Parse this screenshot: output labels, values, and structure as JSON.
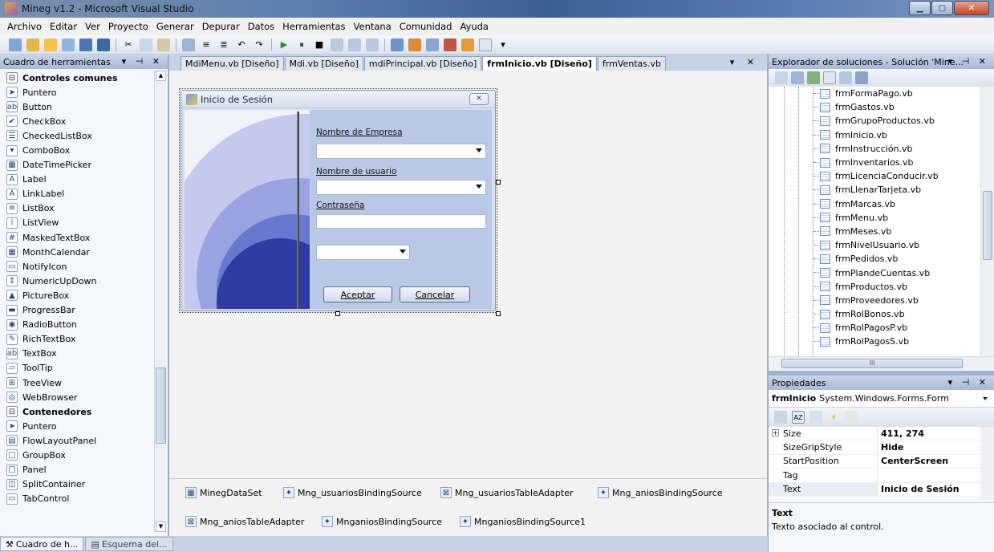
{
  "window": {
    "title": "Mineg v1.2 - Microsoft Visual Studio"
  },
  "menu": [
    "Archivo",
    "Editar",
    "Ver",
    "Proyecto",
    "Generar",
    "Depurar",
    "Datos",
    "Herramientas",
    "Ventana",
    "Comunidad",
    "Ayuda"
  ],
  "toolbox": {
    "title": "Cuadro de herramientas",
    "items": [
      {
        "label": "Controles comunes",
        "group": true,
        "icon": "⊟"
      },
      {
        "label": "Puntero",
        "icon": "➤"
      },
      {
        "label": "Button",
        "icon": "ab"
      },
      {
        "label": "CheckBox",
        "icon": "✔"
      },
      {
        "label": "CheckedListBox",
        "icon": "☰"
      },
      {
        "label": "ComboBox",
        "icon": "▾"
      },
      {
        "label": "DateTimePicker",
        "icon": "▦"
      },
      {
        "label": "Label",
        "icon": "A"
      },
      {
        "label": "LinkLabel",
        "icon": "A"
      },
      {
        "label": "ListBox",
        "icon": "≡"
      },
      {
        "label": "ListView",
        "icon": "⁞"
      },
      {
        "label": "MaskedTextBox",
        "icon": "#"
      },
      {
        "label": "MonthCalendar",
        "icon": "▦"
      },
      {
        "label": "NotifyIcon",
        "icon": "▭"
      },
      {
        "label": "NumericUpDown",
        "icon": "↕"
      },
      {
        "label": "PictureBox",
        "icon": "▲"
      },
      {
        "label": "ProgressBar",
        "icon": "▬"
      },
      {
        "label": "RadioButton",
        "icon": "◉"
      },
      {
        "label": "RichTextBox",
        "icon": "✎"
      },
      {
        "label": "TextBox",
        "icon": "ab"
      },
      {
        "label": "ToolTip",
        "icon": "▱"
      },
      {
        "label": "TreeView",
        "icon": "⊞"
      },
      {
        "label": "WebBrowser",
        "icon": "◎"
      },
      {
        "label": "Contenedores",
        "group": true,
        "icon": "⊟"
      },
      {
        "label": "Puntero",
        "icon": "➤"
      },
      {
        "label": "FlowLayoutPanel",
        "icon": "▤"
      },
      {
        "label": "GroupBox",
        "icon": "▢"
      },
      {
        "label": "Panel",
        "icon": "□"
      },
      {
        "label": "SplitContainer",
        "icon": "◫"
      },
      {
        "label": "TabControl",
        "icon": "▭"
      }
    ]
  },
  "bottom_tabs": [
    {
      "label": "Cuadro de h...",
      "icon": "⚒"
    },
    {
      "label": "Esquema del...",
      "icon": "▤"
    }
  ],
  "doc_tabs": [
    {
      "label": "MdiMenu.vb [Diseño]",
      "active": false
    },
    {
      "label": "Mdi.vb [Diseño]",
      "active": false
    },
    {
      "label": "mdiPrincipal.vb [Diseño]",
      "active": false
    },
    {
      "label": "frmInicio.vb [Diseño]",
      "active": true
    },
    {
      "label": "frmVentas.vb",
      "active": false
    }
  ],
  "form": {
    "title": "Inicio de Sesión",
    "empresa_label": "Nombre de Empresa",
    "usuario_label": "Nombre de usuario",
    "password_label": "Contraseña",
    "accept_label": "Aceptar",
    "cancel_label": "Cancelar"
  },
  "tray": [
    {
      "label": "MinegDataSet",
      "icon": "▦"
    },
    {
      "label": "Mng_usuariosBindingSource",
      "icon": "✦"
    },
    {
      "label": "Mng_usuariosTableAdapter",
      "icon": "⊠"
    },
    {
      "label": "Mng_aniosBindingSource",
      "icon": "✦"
    },
    {
      "label": "Mng_aniosTableAdapter",
      "icon": "⊠"
    },
    {
      "label": "MnganiosBindingSource",
      "icon": "✦"
    },
    {
      "label": "MnganiosBindingSource1",
      "icon": "✦"
    }
  ],
  "solution": {
    "title": "Explorador de soluciones - Solución 'Mine...",
    "files": [
      "frmFormaPago.vb",
      "frmGastos.vb",
      "frmGrupoProductos.vb",
      "frmInicio.vb",
      "frmInstrucción.vb",
      "frmInventarios.vb",
      "frmLicenciaConducir.vb",
      "frmLlenarTarjeta.vb",
      "frmMarcas.vb",
      "frmMenu.vb",
      "frmMeses.vb",
      "frmNivelUsuario.vb",
      "frmPedidos.vb",
      "frmPlandeCuentas.vb",
      "frmProductos.vb",
      "frmProveedores.vb",
      "frmRolBonos.vb",
      "frmRolPagosP.vb",
      "frmRolPagosS.vb"
    ],
    "hscroll_label": "III"
  },
  "properties": {
    "title": "Propiedades",
    "object_name": "frmInicio",
    "object_type": "System.Windows.Forms.Form",
    "rows": [
      {
        "name": "Size",
        "value": "411, 274",
        "expand": true
      },
      {
        "name": "SizeGripStyle",
        "value": "Hide"
      },
      {
        "name": "StartPosition",
        "value": "CenterScreen"
      },
      {
        "name": "Tag",
        "value": ""
      },
      {
        "name": "Text",
        "value": "Inicio de Sesión"
      }
    ],
    "desc_title": "Text",
    "desc_text": "Texto asociado al control."
  }
}
